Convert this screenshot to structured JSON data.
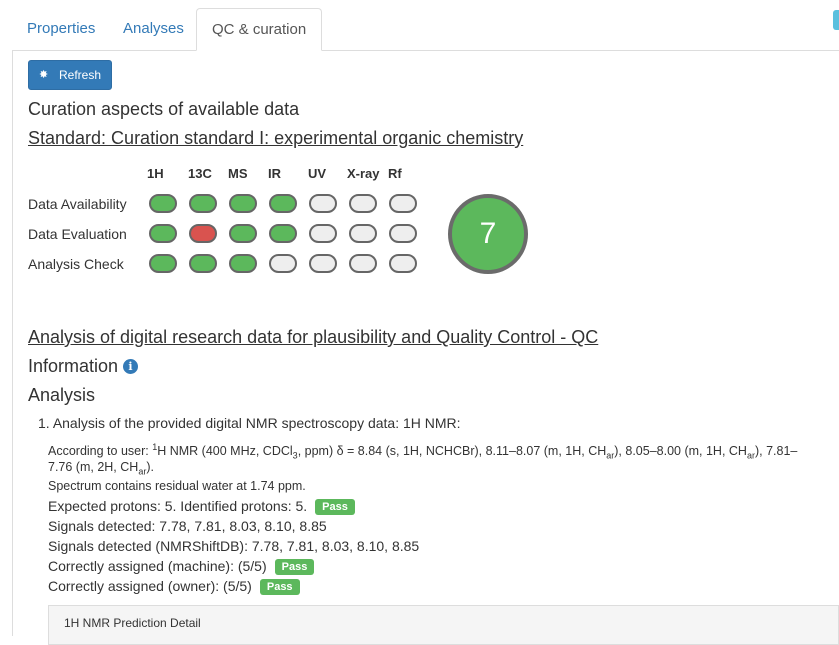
{
  "tabs": [
    {
      "label": "Properties",
      "active": false
    },
    {
      "label": "Analyses",
      "active": false
    },
    {
      "label": "QC & curation",
      "active": true
    }
  ],
  "toolbar": {
    "refresh_label": "Refresh",
    "refresh_icon": "cog-icon"
  },
  "curation": {
    "title": "Curation aspects of available data",
    "standard": "Standard: Curation standard I: experimental organic chemistry",
    "columns": [
      "1H",
      "13C",
      "MS",
      "IR",
      "UV",
      "X-ray",
      "Rf"
    ],
    "rows": [
      {
        "label": "Data Availability",
        "status": [
          "pass",
          "pass",
          "pass",
          "pass",
          "empty",
          "empty",
          "empty"
        ]
      },
      {
        "label": "Data Evaluation",
        "status": [
          "pass",
          "fail",
          "pass",
          "pass",
          "empty",
          "empty",
          "empty"
        ]
      },
      {
        "label": "Analysis Check",
        "status": [
          "pass",
          "pass",
          "pass",
          "empty",
          "empty",
          "empty",
          "empty"
        ]
      }
    ],
    "score": "7",
    "colors": {
      "pass": "#5cb85c",
      "fail": "#d9534f",
      "empty": "#eeeeee",
      "border": "#666666"
    }
  },
  "qc": {
    "title": "Analysis of digital research data for plausibility and Quality Control - QC",
    "information_label": "Information",
    "information_icon": "info-circle-icon",
    "analysis_label": "Analysis",
    "item_number": "1.",
    "item_title": "Analysis of the provided digital NMR spectroscopy data: 1H NMR:",
    "user_text_line1_pre": "According to user: ",
    "user_text_line1": "H NMR (400 MHz, CDCl",
    "user_text_line1_post": ", ppm) δ = 8.84 (s, 1H, NCHCBr), 8.11–8.07 (m, 1H, CH",
    "user_text_line1_b": "), 8.05–8.00 (m, 1H, CH",
    "user_text_line1_c": "), 7.81–",
    "user_text_line2": "7.76 (m, 2H, CH",
    "user_text_line2_post": ").",
    "sup_1": "1",
    "sub_3": "3",
    "sub_ar": "ar",
    "residual_water": "Spectrum contains residual water at 1.74 ppm.",
    "expected": "Expected protons: 5. Identified protons: 5.",
    "signals": "Signals detected: 7.78, 7.81, 8.03, 8.10, 8.85",
    "signals_db": "Signals detected (NMRShiftDB): 7.78, 7.81, 8.03, 8.10, 8.85",
    "assigned_machine": "Correctly assigned (machine): (5/5)",
    "assigned_owner": "Correctly assigned (owner): (5/5)",
    "pass_label": "Pass",
    "prediction_detail": "1H NMR Prediction Detail"
  }
}
